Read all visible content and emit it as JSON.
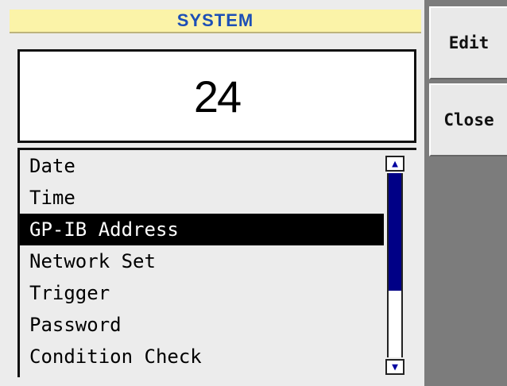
{
  "window": {
    "title": "SYSTEM"
  },
  "display": {
    "value": "24"
  },
  "menu": {
    "items": [
      {
        "label": "Date"
      },
      {
        "label": "Time"
      },
      {
        "label": "GP-IB Address"
      },
      {
        "label": "Network Set"
      },
      {
        "label": "Trigger"
      },
      {
        "label": "Password"
      },
      {
        "label": "Condition Check"
      }
    ],
    "selected": "GP-IB Address"
  },
  "scrollbar": {
    "up_icon": "▲",
    "down_icon": "▼"
  },
  "softkeys": {
    "edit_label": "Edit",
    "close_label": "Close"
  },
  "colors": {
    "title_bg": "#fbf3a8",
    "title_text": "#1d4fb6",
    "selection_bg": "#000000",
    "scroll_thumb": "#000086",
    "side_panel": "#7c7c7c"
  }
}
